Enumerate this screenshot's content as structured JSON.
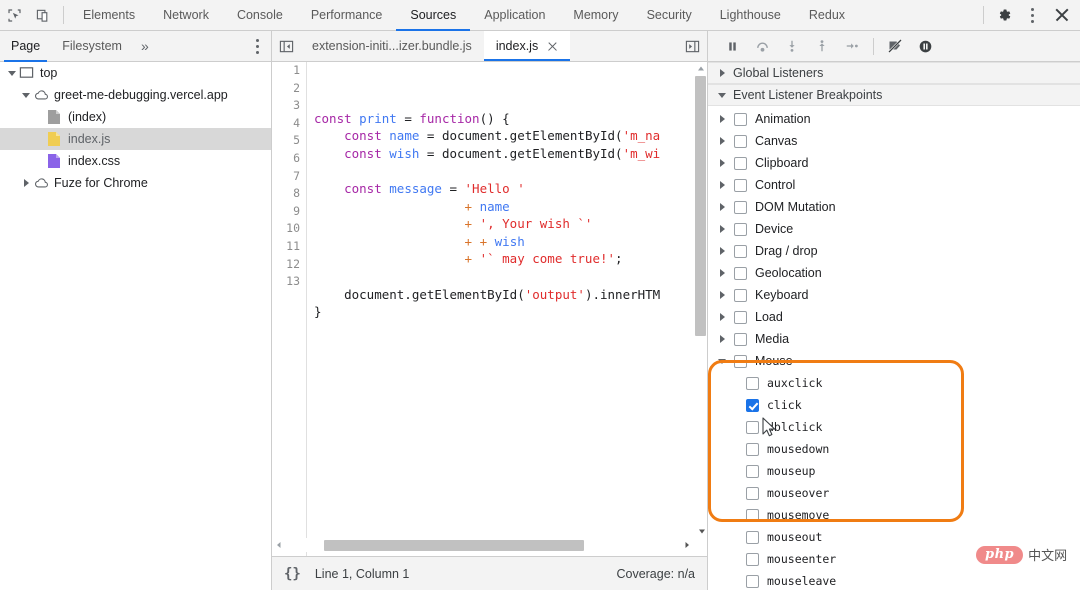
{
  "toolbar": {
    "inspect_icon": "inspect-element-icon",
    "device_icon": "device-toolbar-icon",
    "panels": [
      {
        "label": "Elements",
        "active": false
      },
      {
        "label": "Network",
        "active": false
      },
      {
        "label": "Console",
        "active": false
      },
      {
        "label": "Performance",
        "active": false
      },
      {
        "label": "Sources",
        "active": true
      },
      {
        "label": "Application",
        "active": false
      },
      {
        "label": "Memory",
        "active": false
      },
      {
        "label": "Security",
        "active": false
      },
      {
        "label": "Lighthouse",
        "active": false
      },
      {
        "label": "Redux",
        "active": false
      }
    ],
    "settings_icon": "gear-icon",
    "more_icon": "kebab-menu-icon",
    "close_icon": "close-icon"
  },
  "navigator": {
    "tabs": [
      {
        "label": "Page",
        "active": true
      },
      {
        "label": "Filesystem",
        "active": false
      }
    ],
    "overflow_label": "»",
    "more_icon": "kebab-menu-icon",
    "tree": [
      {
        "label": "top",
        "depth": 0,
        "twisty": "open",
        "icon": "frame-icon"
      },
      {
        "label": "greet-me-debugging.vercel.app",
        "depth": 1,
        "twisty": "open",
        "icon": "cloud-icon"
      },
      {
        "label": "(index)",
        "depth": 2,
        "twisty": "none",
        "icon": "document-icon"
      },
      {
        "label": "index.js",
        "depth": 2,
        "twisty": "none",
        "icon": "js-file-icon",
        "selected": true
      },
      {
        "label": "index.css",
        "depth": 2,
        "twisty": "none",
        "icon": "css-file-icon"
      },
      {
        "label": "Fuze for Chrome",
        "depth": 1,
        "twisty": "closed",
        "icon": "cloud-icon"
      }
    ]
  },
  "editor": {
    "scroll_left_icon": "panel-collapse-left-icon",
    "scroll_right_icon": "panel-expand-right-icon",
    "tabs": [
      {
        "label": "extension-initi...izer.bundle.js",
        "active": false,
        "closable": false
      },
      {
        "label": "index.js",
        "active": true,
        "closable": true
      }
    ],
    "line_numbers": [
      "1",
      "2",
      "3",
      "4",
      "5",
      "6",
      "7",
      "8",
      "9",
      "10",
      "11",
      "12",
      "13"
    ],
    "code_lines": [
      [],
      [
        {
          "t": "const ",
          "c": "kw"
        },
        {
          "t": "print",
          "c": "fn"
        },
        {
          "t": " = ",
          "c": "pln"
        },
        {
          "t": "function",
          "c": "kw"
        },
        {
          "t": "() {",
          "c": "pln"
        }
      ],
      [
        {
          "t": "    ",
          "c": "pln"
        },
        {
          "t": "const ",
          "c": "kw"
        },
        {
          "t": "name",
          "c": "var"
        },
        {
          "t": " = document.getElementById(",
          "c": "pln"
        },
        {
          "t": "'m_na",
          "c": "str"
        }
      ],
      [
        {
          "t": "    ",
          "c": "pln"
        },
        {
          "t": "const ",
          "c": "kw"
        },
        {
          "t": "wish",
          "c": "var"
        },
        {
          "t": " = document.getElementById(",
          "c": "pln"
        },
        {
          "t": "'m_wi",
          "c": "str"
        }
      ],
      [],
      [
        {
          "t": "    ",
          "c": "pln"
        },
        {
          "t": "const ",
          "c": "kw"
        },
        {
          "t": "message",
          "c": "var"
        },
        {
          "t": " = ",
          "c": "pln"
        },
        {
          "t": "'Hello '",
          "c": "str"
        }
      ],
      [
        {
          "t": "                    ",
          "c": "pln"
        },
        {
          "t": "+ ",
          "c": "pl"
        },
        {
          "t": "name",
          "c": "var"
        }
      ],
      [
        {
          "t": "                    ",
          "c": "pln"
        },
        {
          "t": "+ ",
          "c": "pl"
        },
        {
          "t": "', Your wish `'",
          "c": "str"
        }
      ],
      [
        {
          "t": "                    ",
          "c": "pln"
        },
        {
          "t": "+ ",
          "c": "pl"
        },
        {
          "t": "+ ",
          "c": "pl"
        },
        {
          "t": "wish",
          "c": "var"
        }
      ],
      [
        {
          "t": "                    ",
          "c": "pln"
        },
        {
          "t": "+ ",
          "c": "pl"
        },
        {
          "t": "'` may come true!'",
          "c": "str"
        },
        {
          "t": ";",
          "c": "pln"
        }
      ],
      [],
      [
        {
          "t": "    document.getElementById(",
          "c": "pln"
        },
        {
          "t": "'output'",
          "c": "str"
        },
        {
          "t": ").innerHTM",
          "c": "pln"
        }
      ],
      [
        {
          "t": "}",
          "c": "pln"
        }
      ]
    ]
  },
  "debug_toolbar": {
    "buttons": [
      {
        "name": "resume-script-execution",
        "icon": "pause-icon"
      },
      {
        "name": "step-over-next-function-call",
        "icon": "step-over-icon"
      },
      {
        "name": "step-into-next-function-call",
        "icon": "step-into-icon"
      },
      {
        "name": "step-out-of-current-function",
        "icon": "step-out-icon"
      },
      {
        "name": "step",
        "icon": "step-icon"
      },
      {
        "name": "deactivate-breakpoints",
        "icon": "deactivate-breakpoints-icon"
      },
      {
        "name": "pause-on-exceptions",
        "icon": "pause-on-exceptions-icon"
      }
    ]
  },
  "statusbar": {
    "pretty_print_icon": "{}",
    "position": "Line 1, Column 1",
    "coverage": "Coverage: n/a"
  },
  "sidebar": {
    "sections": [
      {
        "title": "Global Listeners",
        "expanded": false
      },
      {
        "title": "Event Listener Breakpoints",
        "expanded": true
      }
    ],
    "categories": [
      {
        "label": "Animation",
        "state": "unchecked",
        "expanded": false
      },
      {
        "label": "Canvas",
        "state": "unchecked",
        "expanded": false
      },
      {
        "label": "Clipboard",
        "state": "unchecked",
        "expanded": false
      },
      {
        "label": "Control",
        "state": "unchecked",
        "expanded": false
      },
      {
        "label": "DOM Mutation",
        "state": "unchecked",
        "expanded": false
      },
      {
        "label": "Device",
        "state": "unchecked",
        "expanded": false
      },
      {
        "label": "Drag / drop",
        "state": "unchecked",
        "expanded": false
      },
      {
        "label": "Geolocation",
        "state": "unchecked",
        "expanded": false
      },
      {
        "label": "Keyboard",
        "state": "unchecked",
        "expanded": false
      },
      {
        "label": "Load",
        "state": "unchecked",
        "expanded": false
      },
      {
        "label": "Media",
        "state": "unchecked",
        "expanded": false
      },
      {
        "label": "Mouse",
        "state": "indeterminate",
        "expanded": true
      }
    ],
    "mouse_events": [
      {
        "label": "auxclick",
        "state": "unchecked"
      },
      {
        "label": "click",
        "state": "checked"
      },
      {
        "label": "dblclick",
        "state": "unchecked"
      },
      {
        "label": "mousedown",
        "state": "unchecked"
      },
      {
        "label": "mouseup",
        "state": "unchecked"
      },
      {
        "label": "mouseover",
        "state": "unchecked"
      },
      {
        "label": "mousemove",
        "state": "unchecked"
      },
      {
        "label": "mouseout",
        "state": "unchecked"
      },
      {
        "label": "mouseenter",
        "state": "unchecked"
      },
      {
        "label": "mouseleave",
        "state": "unchecked"
      }
    ]
  },
  "annotation": {
    "name": "highlight-box",
    "color": "#f07c13"
  },
  "watermark": {
    "logo_text": "php",
    "site_text": "中文网"
  },
  "colors": {
    "accent": "#1a73e8",
    "highlight": "#f07c13",
    "toolbar_bg": "#f3f3f3",
    "border": "#cdcdcd"
  }
}
